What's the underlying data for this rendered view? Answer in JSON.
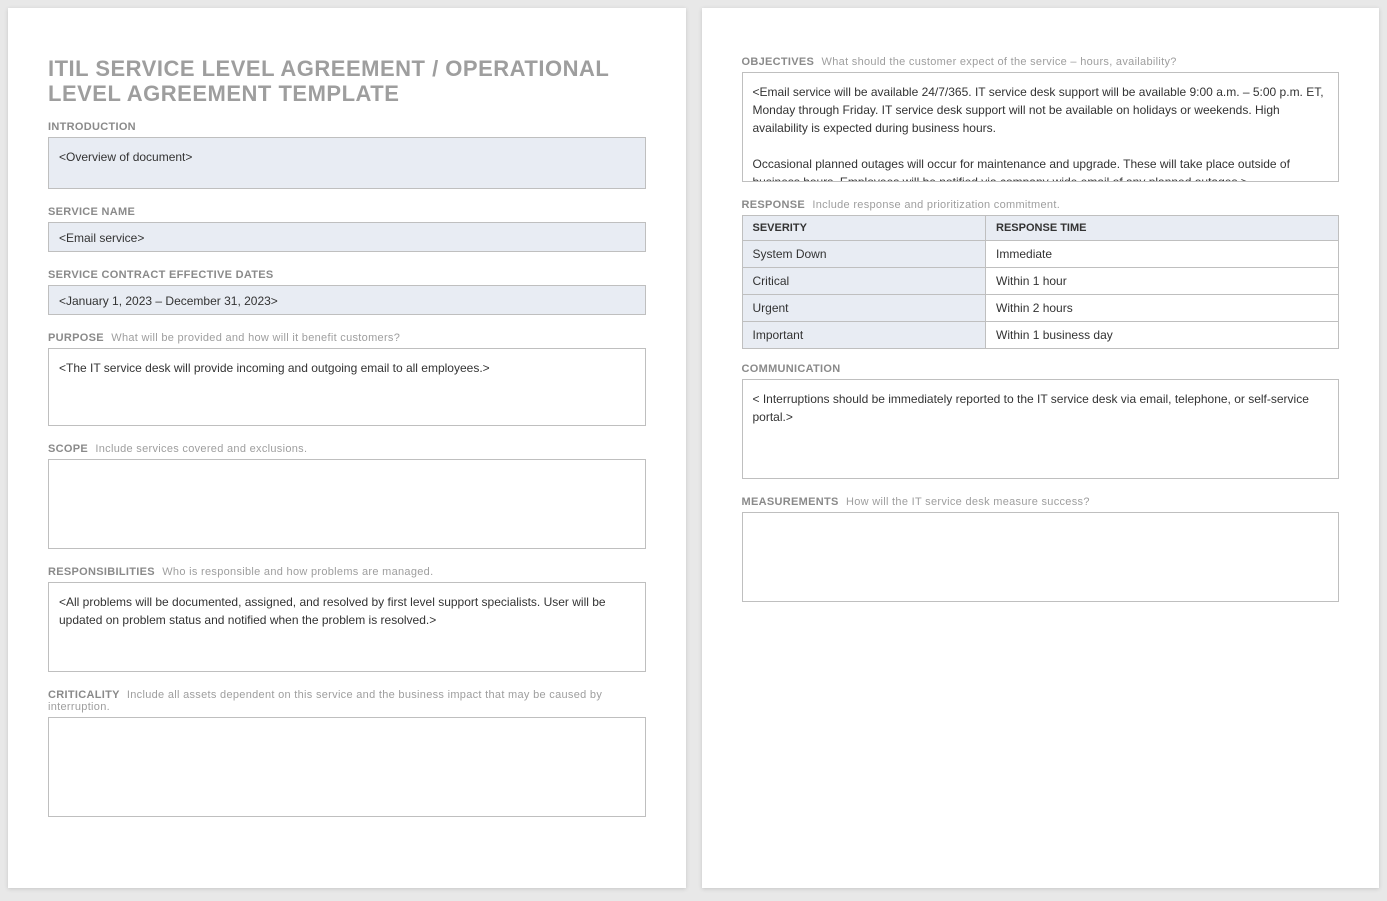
{
  "title": "ITIL SERVICE LEVEL AGREEMENT / OPERATIONAL LEVEL AGREEMENT TEMPLATE",
  "sections": {
    "introduction": {
      "label": "INTRODUCTION",
      "value": "<Overview of document>"
    },
    "service_name": {
      "label": "SERVICE NAME",
      "value": "<Email service>"
    },
    "contract_dates": {
      "label": "SERVICE CONTRACT EFFECTIVE DATES",
      "value": "<January 1, 2023 – December 31, 2023>"
    },
    "purpose": {
      "label": "PURPOSE",
      "hint": "What will be provided and how will it benefit customers?",
      "value": "<The IT service desk will provide incoming and outgoing email to all employees.>"
    },
    "scope": {
      "label": "SCOPE",
      "hint": "Include services covered and exclusions.",
      "value": ""
    },
    "responsibilities": {
      "label": "RESPONSIBILITIES",
      "hint": "Who is responsible and how problems are managed.",
      "value": "<All problems will be documented, assigned, and resolved by first level support specialists. User will be updated on problem status and notified when the problem is resolved.>"
    },
    "criticality": {
      "label": "CRITICALITY",
      "hint": "Include all assets dependent on this service and the business impact that may be caused by interruption.",
      "value": ""
    },
    "objectives": {
      "label": "OBJECTIVES",
      "hint": "What should the customer expect of the service – hours, availability?",
      "value": "<Email service will be available 24/7/365. IT service desk support will be available 9:00 a.m. – 5:00 p.m. ET, Monday through Friday. IT service desk support will not be available on holidays or weekends. High availability is expected during business hours.\n\nOccasional planned outages will occur for maintenance and upgrade. These will take place outside of business hours. Employees will be notified via company-wide email of any planned outages.>"
    },
    "response": {
      "label": "RESPONSE",
      "hint": "Include response and prioritization commitment.",
      "headers": {
        "severity": "SEVERITY",
        "time": "RESPONSE TIME"
      },
      "rows": [
        {
          "severity": "System Down",
          "time": "Immediate"
        },
        {
          "severity": "Critical",
          "time": "Within 1 hour"
        },
        {
          "severity": "Urgent",
          "time": "Within 2 hours"
        },
        {
          "severity": "Important",
          "time": "Within 1 business day"
        }
      ]
    },
    "communication": {
      "label": "COMMUNICATION",
      "value": "< Interruptions should be immediately reported to the IT service desk via email, telephone, or self-service portal.>"
    },
    "measurements": {
      "label": "MEASUREMENTS",
      "hint": "How will the IT service desk measure success?",
      "value": ""
    }
  }
}
